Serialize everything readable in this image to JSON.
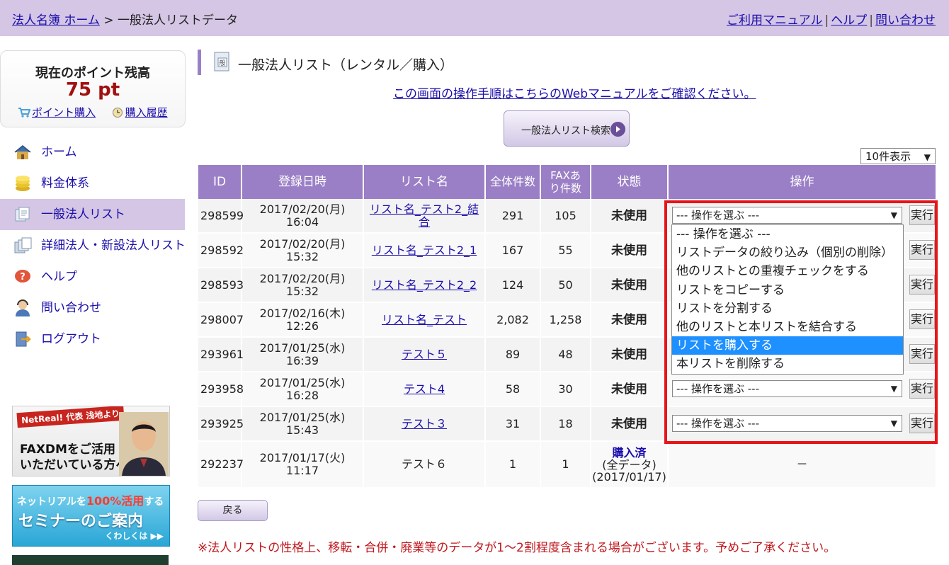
{
  "breadcrumb": {
    "home": "法人名簿 ホーム",
    "sep": " > ",
    "current": "一般法人リストデータ"
  },
  "toplinks": [
    "ご利用マニュアル",
    "ヘルプ",
    "問い合わせ"
  ],
  "points": {
    "title": "現在のポイント残高",
    "value": "75 pt",
    "buy": "ポイント購入",
    "history": "購入履歴"
  },
  "nav": [
    {
      "label": "ホーム",
      "icon": "house-icon",
      "active": false
    },
    {
      "label": "料金体系",
      "icon": "coins-icon",
      "active": false
    },
    {
      "label": "一般法人リスト",
      "icon": "documents-icon",
      "active": true
    },
    {
      "label": "詳細法人・新設法人リスト",
      "icon": "documents-stack-icon",
      "active": false
    },
    {
      "label": "ヘルプ",
      "icon": "question-bubble-icon",
      "active": false
    },
    {
      "label": "問い合わせ",
      "icon": "operator-icon",
      "active": false
    },
    {
      "label": "ログアウト",
      "icon": "logout-icon",
      "active": false
    }
  ],
  "banners": {
    "b1_tag": "NetReal! 代表 浅地より",
    "b1_text1": "FAXDMをご活用",
    "b1_text2": "いただいている方へ",
    "b2_text1": "ネットリアルを",
    "b2_pct": "100%活用",
    "b2_text1b": "する",
    "b2_text2": "セミナーのご案内",
    "b2_text3": "くわしくは ▶▶"
  },
  "page_title": "一般法人リスト（レンタル／購入）",
  "manual_link": "この画面の操作手順はこちらのWebマニュアルをご確認ください。",
  "search_button": "一般法人リスト検索",
  "per_page": "10件表示",
  "table": {
    "headers": [
      "ID",
      "登録日時",
      "リスト名",
      "全体件数",
      "FAXあり件数",
      "状態",
      "操作"
    ],
    "rows": [
      {
        "id": "298599",
        "date": "2017/02/20(月)",
        "time": "16:04",
        "name": "リスト名_テスト2_結合",
        "total": "291",
        "fax": "105",
        "status": "未使用"
      },
      {
        "id": "298592",
        "date": "2017/02/20(月)",
        "time": "15:32",
        "name": "リスト名_テスト2_1",
        "total": "167",
        "fax": "55",
        "status": "未使用"
      },
      {
        "id": "298593",
        "date": "2017/02/20(月)",
        "time": "15:32",
        "name": "リスト名_テスト2_2",
        "total": "124",
        "fax": "50",
        "status": "未使用"
      },
      {
        "id": "298007",
        "date": "2017/02/16(木)",
        "time": "12:26",
        "name": "リスト名_テスト",
        "total": "2,082",
        "fax": "1,258",
        "status": "未使用"
      },
      {
        "id": "293961",
        "date": "2017/01/25(水)",
        "time": "16:39",
        "name": "テスト５",
        "total": "89",
        "fax": "48",
        "status": "未使用"
      },
      {
        "id": "293958",
        "date": "2017/01/25(水)",
        "time": "16:28",
        "name": "テスト4",
        "total": "58",
        "fax": "30",
        "status": "未使用"
      },
      {
        "id": "293925",
        "date": "2017/01/25(水)",
        "time": "15:43",
        "name": "テスト３",
        "total": "31",
        "fax": "18",
        "status": "未使用"
      },
      {
        "id": "292237",
        "date": "2017/01/17(火)",
        "time": "11:17",
        "name": "テスト６",
        "total": "1",
        "fax": "1",
        "status_line1": "購入済",
        "status_line2": "(全データ)",
        "status_line3": "(2017/01/17)",
        "op": "－"
      }
    ],
    "select_default": "--- 操作を選ぶ ---",
    "exec_label": "実行"
  },
  "dropdown_options": [
    "--- 操作を選ぶ ---",
    "リストデータの絞り込み（個別の削除）",
    "他のリストとの重複チェックをする",
    "リストをコピーする",
    "リストを分割する",
    "他のリストと本リストを結合する",
    "リストを購入する",
    "本リストを削除する"
  ],
  "dropdown_highlighted": "リストを購入する",
  "back_button": "戻る",
  "note": "※法人リストの性格上、移転・合併・廃業等のデータが1～2割程度含まれる場合がございます。予めご了承ください。",
  "colors": {
    "header_bg": "#d4c6e4",
    "table_head": "#9b7fc6",
    "highlight": "#e8141a",
    "link": "#1a0dab",
    "selected_option": "#1e90ff"
  }
}
